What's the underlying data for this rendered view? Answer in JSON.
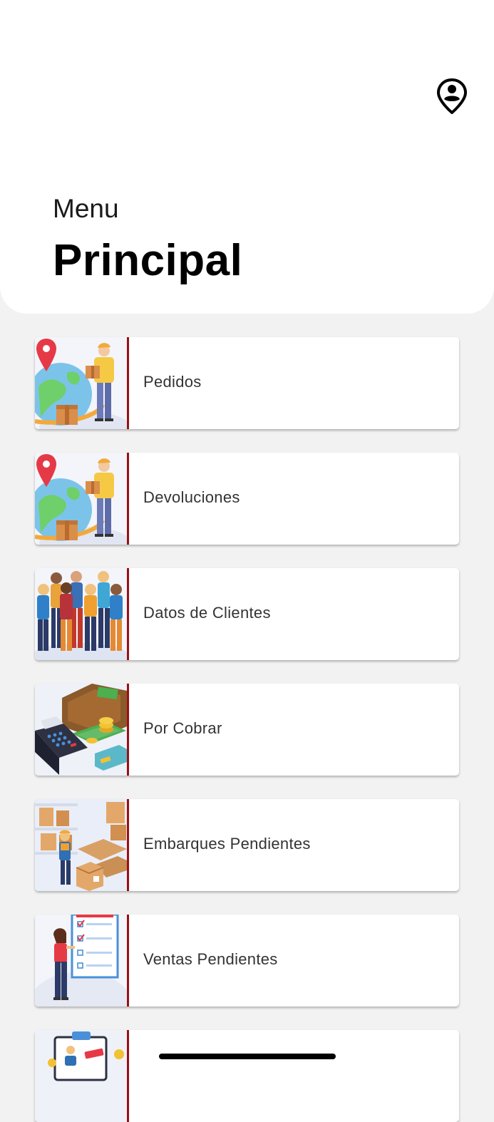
{
  "header": {
    "subtitle": "Menu",
    "title": "Principal"
  },
  "menu": {
    "items": [
      {
        "label": "Pedidos",
        "icon": "delivery-globe-illustration"
      },
      {
        "label": "Devoluciones",
        "icon": "delivery-globe-illustration"
      },
      {
        "label": "Datos de Clientes",
        "icon": "customers-group-illustration"
      },
      {
        "label": "Por Cobrar",
        "icon": "wallet-payment-illustration"
      },
      {
        "label": "Embarques Pendientes",
        "icon": "warehouse-boxes-illustration"
      },
      {
        "label": "Ventas Pendientes",
        "icon": "checklist-clipboard-illustration"
      },
      {
        "label": "",
        "icon": "id-card-illustration"
      }
    ]
  },
  "colors": {
    "accent": "#9b0f14",
    "header_bg": "#ffffff",
    "page_bg": "#f2f2f2"
  }
}
